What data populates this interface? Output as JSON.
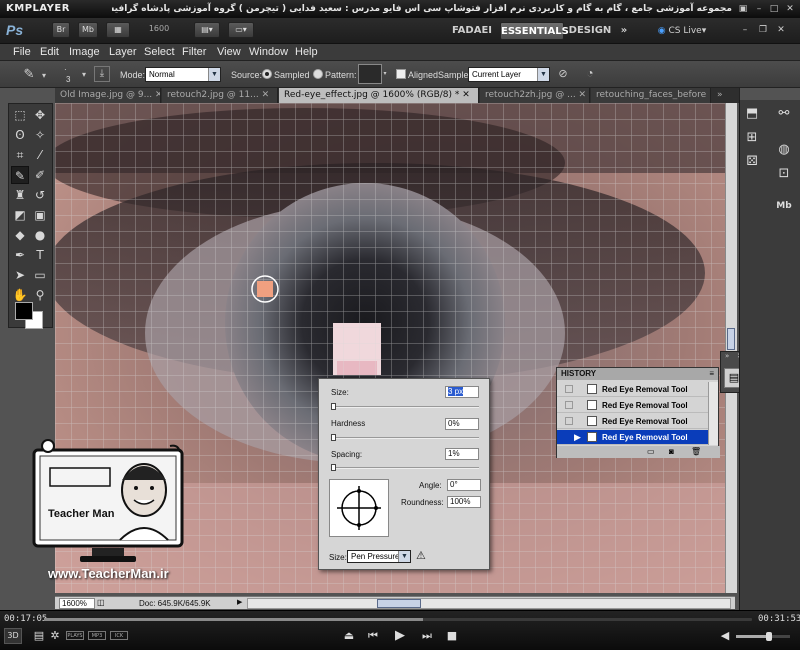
{
  "player": {
    "logo": "KMPLAYER",
    "caption": "مجموعه آموزشی جامع ، گام به گام و کاربردی نرم افزار فتوشاپ سی اس فایو   مدرس : سعید فدایی ( تیچرمن ) گروه آموزشی پادشاه گرافیست ها",
    "current_time": "00:17:05",
    "total_time": "00:31:53",
    "progress": 0.536,
    "badges": [
      "3D",
      "PLAYS",
      "MP3",
      "ICK"
    ]
  },
  "appbar": {
    "logo": "Ps",
    "br": "Br",
    "mb": "Mb",
    "zoom": "1600",
    "workspaces": [
      "FADAEI",
      "ESSENTIALS",
      "DESIGN"
    ],
    "more": "»",
    "cslive": "CS Live"
  },
  "menu": [
    "File",
    "Edit",
    "Image",
    "Layer",
    "Select",
    "Filter",
    "View",
    "Window",
    "Help"
  ],
  "options": {
    "brush_size": "3",
    "mode_label": "Mode:",
    "mode_value": "Normal",
    "source_label": "Source:",
    "sampled_label": "Sampled",
    "pattern_label": "Pattern:",
    "aligned_label": "Aligned",
    "sample_label": "Sample:",
    "sample_value": "Current Layer"
  },
  "tabs": [
    "Old Image.jpg @ 9...",
    "retouch2.jpg @ 11...",
    "Red-eye_effect.jpg @ 1600% (RGB/8) *",
    "retouch2zh.jpg @ ...",
    "retouching_faces_before"
  ],
  "status": {
    "zoom": "1600%",
    "doc": "Doc: 645.9K/645.9K"
  },
  "brush_panel": {
    "size_label": "Size:",
    "size_value": "3 px",
    "hardness_label": "Hardness",
    "hardness_value": "0%",
    "spacing_label": "Spacing:",
    "spacing_value": "1%",
    "angle_label": "Angle:",
    "angle_value": "0°",
    "roundness_label": "Roundness:",
    "roundness_value": "100%",
    "size_ctrl_label": "Size:",
    "size_ctrl_value": "Pen Pressure"
  },
  "history": {
    "title": "HISTORY",
    "items": [
      "Red Eye Removal Tool",
      "Red Eye Removal Tool",
      "Red Eye Removal Tool",
      "Red Eye Removal Tool"
    ],
    "active_index": 3
  },
  "watermark": {
    "name": "Teacher Man",
    "url": "www.TeacherMan.ir"
  }
}
